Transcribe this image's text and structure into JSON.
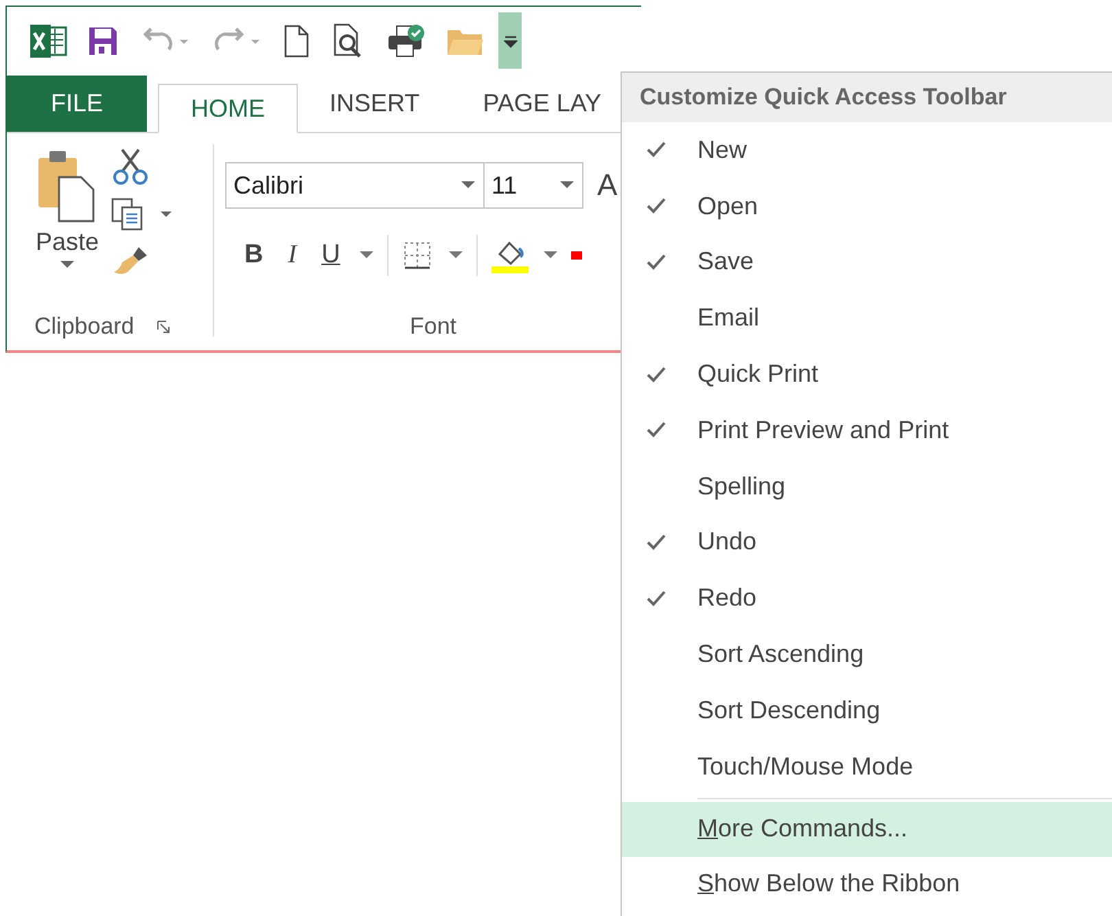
{
  "tabs": [
    {
      "label": "FILE",
      "kind": "file",
      "selected": false
    },
    {
      "label": "HOME",
      "kind": "tab",
      "selected": true
    },
    {
      "label": "INSERT",
      "kind": "tab",
      "selected": false
    },
    {
      "label": "PAGE LAY",
      "kind": "tab",
      "selected": false
    }
  ],
  "clipboard": {
    "paste_label": "Paste",
    "group_label": "Clipboard"
  },
  "font": {
    "name": "Calibri",
    "size": "11",
    "grow_label": "A",
    "bold": "B",
    "italic": "I",
    "underline": "U",
    "group_label": "Font"
  },
  "menu": {
    "title": "Customize Quick Access Toolbar",
    "items": [
      {
        "label": "New",
        "kind": "toggle",
        "checked": true,
        "selected": false,
        "mnemonic": false
      },
      {
        "label": "Open",
        "kind": "toggle",
        "checked": true,
        "selected": false,
        "mnemonic": false
      },
      {
        "label": "Save",
        "kind": "toggle",
        "checked": true,
        "selected": false,
        "mnemonic": false
      },
      {
        "label": "Email",
        "kind": "toggle",
        "checked": false,
        "selected": false,
        "mnemonic": false
      },
      {
        "label": "Quick Print",
        "kind": "toggle",
        "checked": true,
        "selected": false,
        "mnemonic": false
      },
      {
        "label": "Print Preview and Print",
        "kind": "toggle",
        "checked": true,
        "selected": false,
        "mnemonic": false
      },
      {
        "label": "Spelling",
        "kind": "toggle",
        "checked": false,
        "selected": false,
        "mnemonic": false
      },
      {
        "label": "Undo",
        "kind": "toggle",
        "checked": true,
        "selected": false,
        "mnemonic": false
      },
      {
        "label": "Redo",
        "kind": "toggle",
        "checked": true,
        "selected": false,
        "mnemonic": false
      },
      {
        "label": "Sort Ascending",
        "kind": "toggle",
        "checked": false,
        "selected": false,
        "mnemonic": false
      },
      {
        "label": "Sort Descending",
        "kind": "toggle",
        "checked": false,
        "selected": false,
        "mnemonic": false
      },
      {
        "label": "Touch/Mouse Mode",
        "kind": "toggle",
        "checked": false,
        "selected": false,
        "mnemonic": false
      },
      {
        "label": "More Commands...",
        "kind": "command",
        "checked": false,
        "selected": true,
        "mnemonic": true
      },
      {
        "label": "Show Below the Ribbon",
        "kind": "command",
        "checked": false,
        "selected": false,
        "mnemonic": true
      }
    ]
  }
}
